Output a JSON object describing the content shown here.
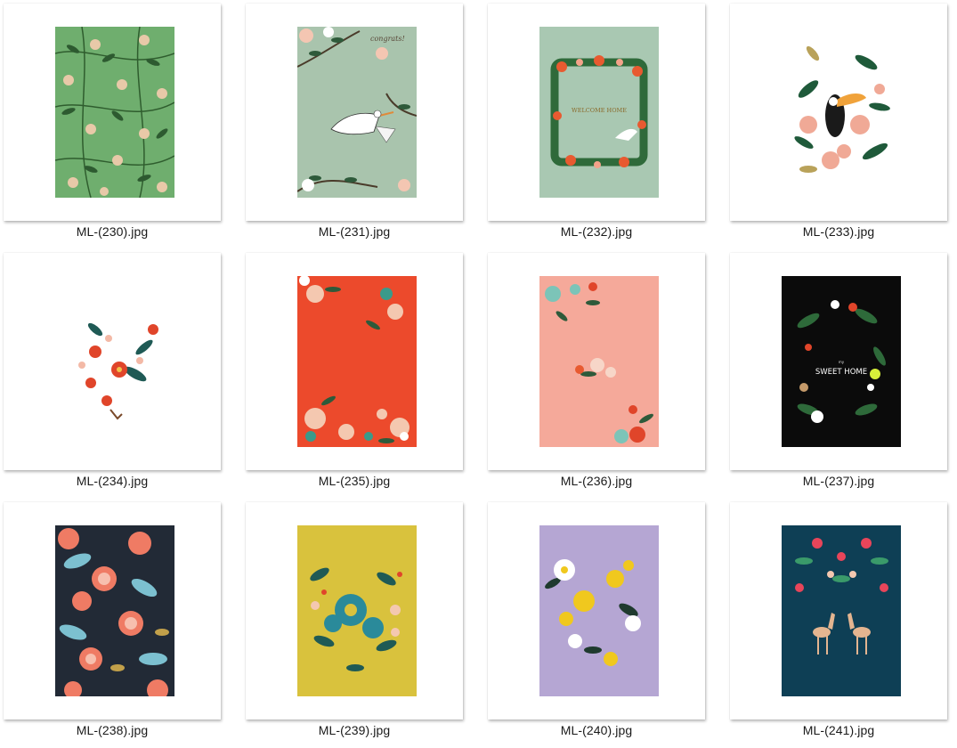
{
  "files": [
    {
      "name": "ML-(230).jpg",
      "background": "#6fae6e",
      "motif": "green-leaf-pattern"
    },
    {
      "name": "ML-(231).jpg",
      "background": "#a9c4ad",
      "motif": "stork-congrats",
      "text": "congrats!"
    },
    {
      "name": "ML-(232).jpg",
      "background": "#a9c8b2",
      "motif": "floral-wreath",
      "text": "WELCOME HOME"
    },
    {
      "name": "ML-(233).jpg",
      "background": "#ffffff",
      "motif": "toucan-floral"
    },
    {
      "name": "ML-(234).jpg",
      "background": "#ffffff",
      "motif": "red-bouquet"
    },
    {
      "name": "ML-(235).jpg",
      "background": "#ec4a2c",
      "motif": "red-floral-border"
    },
    {
      "name": "ML-(236).jpg",
      "background": "#f5a99a",
      "motif": "pink-floral-corners"
    },
    {
      "name": "ML-(237).jpg",
      "background": "#0b0b0b",
      "motif": "sweet-home-wreath",
      "text_small": "my",
      "text": "SWEET HOME"
    },
    {
      "name": "ML-(238).jpg",
      "background": "#222a36",
      "motif": "dense-floral-pattern"
    },
    {
      "name": "ML-(239).jpg",
      "background": "#d9c23d",
      "motif": "blue-floral-spray"
    },
    {
      "name": "ML-(240).jpg",
      "background": "#b5a6d3",
      "motif": "yellow-white-flowers"
    },
    {
      "name": "ML-(241).jpg",
      "background": "#0e3f55",
      "motif": "deer-floral"
    }
  ]
}
